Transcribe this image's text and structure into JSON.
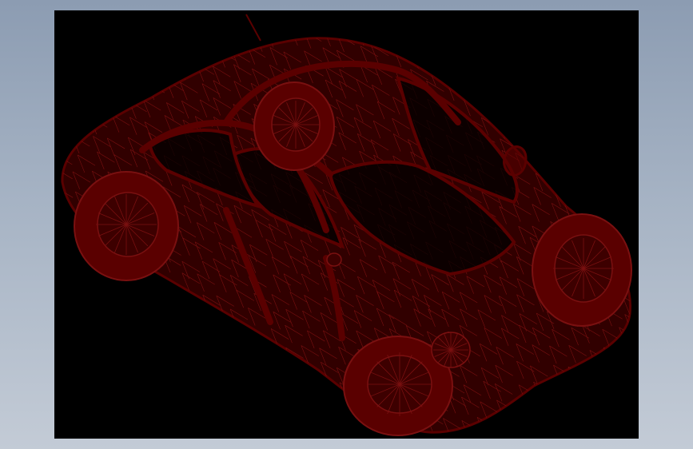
{
  "scene": {
    "background_color": "#000000",
    "frame_color": "#9aa7ba",
    "model": {
      "subject": "car",
      "render_style": "wireframe",
      "wire_color": "#5a0000",
      "wire_light_color": "#7a1010"
    }
  }
}
